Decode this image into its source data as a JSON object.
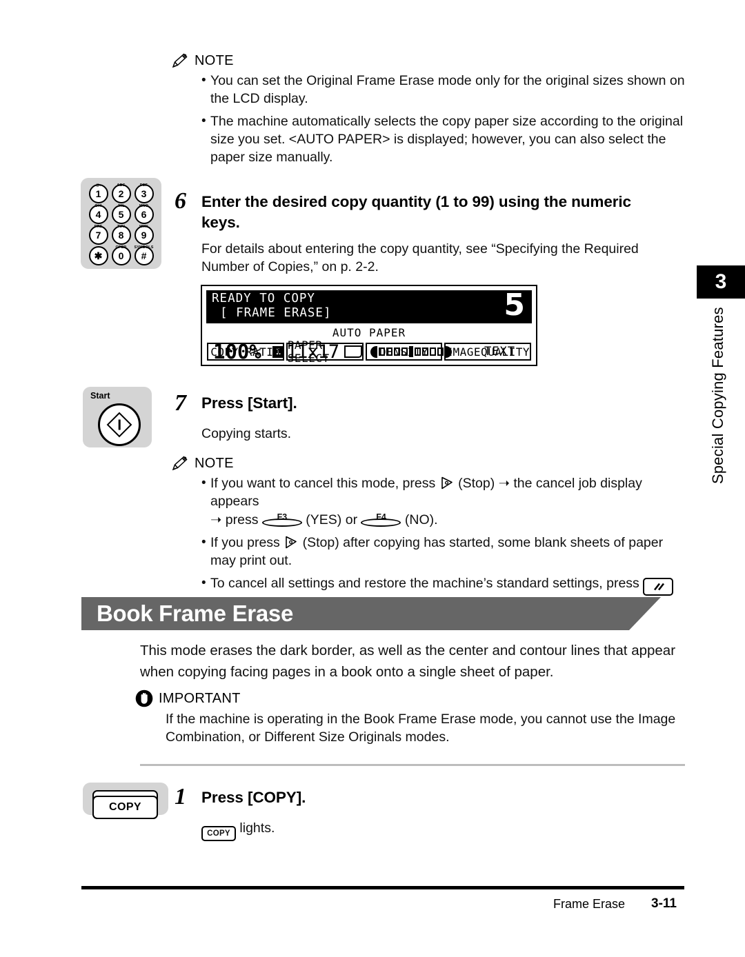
{
  "page": {
    "footer_section": "Frame Erase",
    "footer_page": "3-11",
    "side_tab_number": "3",
    "side_tab_label": "Special Copying Features"
  },
  "note_top": {
    "label": "NOTE",
    "bullets": [
      "You can set the Original Frame Erase mode only for the original sizes shown on the LCD display.",
      "The machine automatically selects the copy paper size according to the original size you set. <AUTO PAPER> is displayed; however, you can also select the paper size manually."
    ]
  },
  "step6": {
    "number": "6",
    "title": "Enter the desired copy quantity (1 to 99) using the numeric keys.",
    "body": "For details about entering the copy quantity, see “Specifying the Required Number of Copies,” on p. 2-2.",
    "keypad": {
      "keys": [
        {
          "sub": "@.",
          "digit": "1"
        },
        {
          "sub": "ABC",
          "digit": "2"
        },
        {
          "sub": "DEF",
          "digit": "3"
        },
        {
          "sub": "GHI",
          "digit": "4"
        },
        {
          "sub": "JKL",
          "digit": "5"
        },
        {
          "sub": "MNO",
          "digit": "6"
        },
        {
          "sub": "PRS",
          "digit": "7"
        },
        {
          "sub": "TUV",
          "digit": "8"
        },
        {
          "sub": "WXY",
          "digit": "9"
        },
        {
          "sub": "",
          "digit": "✱"
        },
        {
          "sub": "OPER",
          "digit": "0"
        },
        {
          "sub": "SYMBOLS",
          "digit": "#"
        }
      ]
    }
  },
  "lcd": {
    "line1": "READY TO COPY",
    "line2": "[ FRAME ERASE]",
    "count": "5",
    "auto_paper": "AUTO PAPER",
    "ratio": "100%",
    "tray": "1",
    "size": "11x17",
    "quality": "TEXT",
    "buttons": [
      "COPY RATIO",
      "PAPER SELECT",
      "DENSITY",
      "IMAGEQUALITY"
    ]
  },
  "step7": {
    "number": "7",
    "title": "Press [Start].",
    "body": "Copying starts.",
    "key_label": "Start"
  },
  "note_bottom": {
    "label": "NOTE",
    "b1_a": "If you want to cancel this mode, press",
    "b1_b": "(Stop)",
    "b1_c": "the cancel job display appears",
    "b1_d": "press",
    "b1_f3": "F3",
    "b1_yes": "(YES) or",
    "b1_f4": "F4",
    "b1_no": "(NO).",
    "b2_a": "If you press",
    "b2_b": "(Stop) after copying has started, some blank sheets of paper may print out.",
    "b3_a": "To cancel all settings and restore the machine’s standard settings, press",
    "b3_b": "(Reset)."
  },
  "section": {
    "banner_title": "Book Frame Erase",
    "intro": "This mode erases the dark border, as well as the center and contour lines that appear when copying facing pages in a book onto a single sheet of paper."
  },
  "important": {
    "label": "IMPORTANT",
    "body": "If the machine is operating in the Book Frame Erase mode, you cannot use the Image Combination, or Different Size Originals modes."
  },
  "step1": {
    "number": "1",
    "title": "Press [COPY].",
    "key_label": "COPY",
    "body_badge": "COPY",
    "body_after": "lights."
  },
  "colors": {
    "banner_gray": "#666666",
    "key_gray": "#d4d4d4",
    "rule_gray": "#bdbdbd"
  }
}
